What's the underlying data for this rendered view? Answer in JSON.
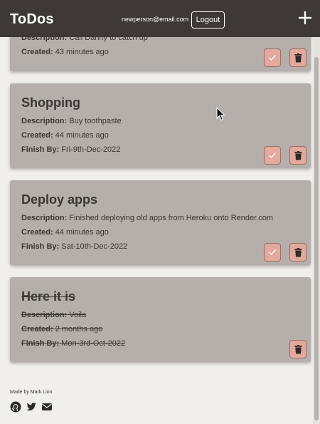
{
  "header": {
    "title": "ToDos",
    "user_email": "newperson@email.com",
    "logout_label": "Logout"
  },
  "todos": [
    {
      "description_label": "Description:",
      "description": "Call Danny to catch up",
      "created_label": "Created:",
      "created": "43 minutes ago"
    },
    {
      "title": "Shopping",
      "description_label": "Description:",
      "description": "Buy toothpaste",
      "created_label": "Created:",
      "created": "44 minutes ago",
      "finish_label": "Finish By:",
      "finish_by": "Fri-9th-Dec-2022"
    },
    {
      "title": "Deploy apps",
      "description_label": "Description:",
      "description": "Finished deploying old apps from Heroku onto Render.com",
      "created_label": "Created:",
      "created": "44 minutes ago",
      "finish_label": "Finish By:",
      "finish_by": "Sat-10th-Dec-2022"
    },
    {
      "title": "Here it is",
      "description_label": "Description:",
      "description": "Voila",
      "created_label": "Created:",
      "created": "2 months ago",
      "finish_label": "Finish By:",
      "finish_by": "Mon-3rd-Oct-2022",
      "completed": true
    }
  ],
  "footer": {
    "credit": "Made by Mark Linn",
    "icons": [
      "github-icon",
      "twitter-icon",
      "email-icon"
    ]
  },
  "colors": {
    "header_bg": "#3e3936",
    "page_bg": "#f1efeb",
    "card_bg": "#b4afaa",
    "button_bg": "#e3a99a"
  }
}
